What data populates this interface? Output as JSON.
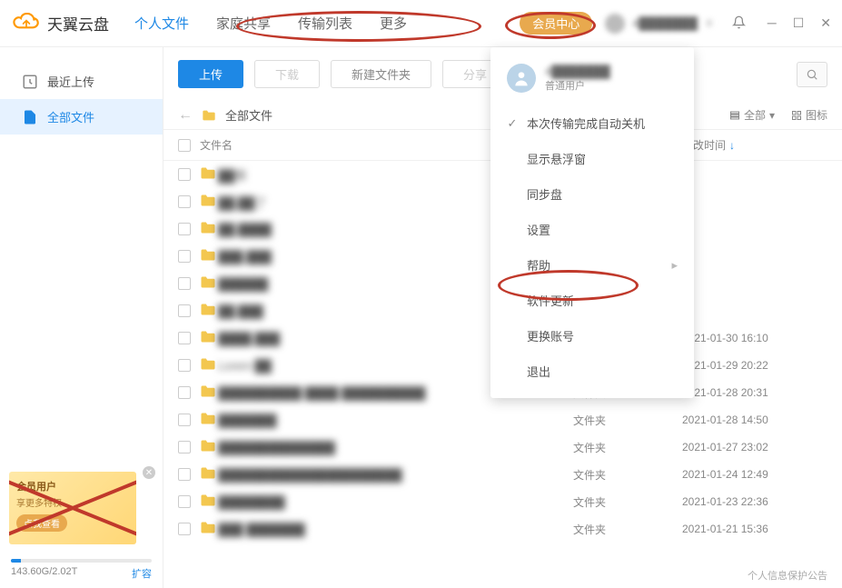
{
  "app": {
    "logo_text": "天翼云盘"
  },
  "nav": {
    "personal": "个人文件",
    "family": "家庭共享",
    "transfer": "传输列表",
    "more": "更多"
  },
  "header": {
    "member_center": "会员中心",
    "username": "4███████",
    "crown": "♛"
  },
  "sidebar": {
    "recent": "最近上传",
    "all_files": "全部文件"
  },
  "promo": {
    "title": "会员用户",
    "sub": "享更多特权",
    "btn": "点我查看"
  },
  "storage": {
    "used_total": "143.60G/2.02T",
    "expand": "扩容"
  },
  "toolbar": {
    "upload": "上传",
    "download": "下载",
    "new_folder": "新建文件夹",
    "share": "分享"
  },
  "breadcrumb": {
    "all_files": "全部文件"
  },
  "view": {
    "all": "全部",
    "icon": "图标"
  },
  "columns": {
    "name": "文件名",
    "mod_time": "修改时间"
  },
  "menu": {
    "username": "4███████",
    "usertype": "普通用户",
    "auto_shutdown": "本次传输完成自动关机",
    "float_window": "显示悬浮窗",
    "sync_disk": "同步盘",
    "settings": "设置",
    "help": "帮助",
    "update": "软件更新",
    "switch_account": "更换账号",
    "exit": "退出"
  },
  "files": [
    {
      "name": "██哥",
      "type": "",
      "time": ""
    },
    {
      "name": "██,██了",
      "type": "",
      "time": ""
    },
    {
      "name": "██,████",
      "type": "",
      "time": ""
    },
    {
      "name": "███,███",
      "type": "",
      "time": ""
    },
    {
      "name": "██████",
      "type": "",
      "time": ""
    },
    {
      "name": "██,███",
      "type": "",
      "time": ""
    },
    {
      "name": "████,███",
      "type": "",
      "time": "2021-01-30 16:10"
    },
    {
      "name": "Lorem ██",
      "type": "文件夹",
      "time": "2021-01-29 20:22"
    },
    {
      "name": "██████████ ████ ██████████",
      "type": "文件夹",
      "time": "2021-01-28 20:31"
    },
    {
      "name": "███████",
      "type": "文件夹",
      "time": "2021-01-28 14:50"
    },
    {
      "name": "██████████████",
      "type": "文件夹",
      "time": "2021-01-27 23:02"
    },
    {
      "name": "██████████████████████",
      "type": "文件夹",
      "time": "2021-01-24 12:49"
    },
    {
      "name": "████████",
      "type": "文件夹",
      "time": "2021-01-23 22:36"
    },
    {
      "name": "███ ███████",
      "type": "文件夹",
      "time": "2021-01-21 15:36"
    }
  ],
  "footer": {
    "privacy": "个人信息保护公告"
  },
  "type_label": "文件夹"
}
